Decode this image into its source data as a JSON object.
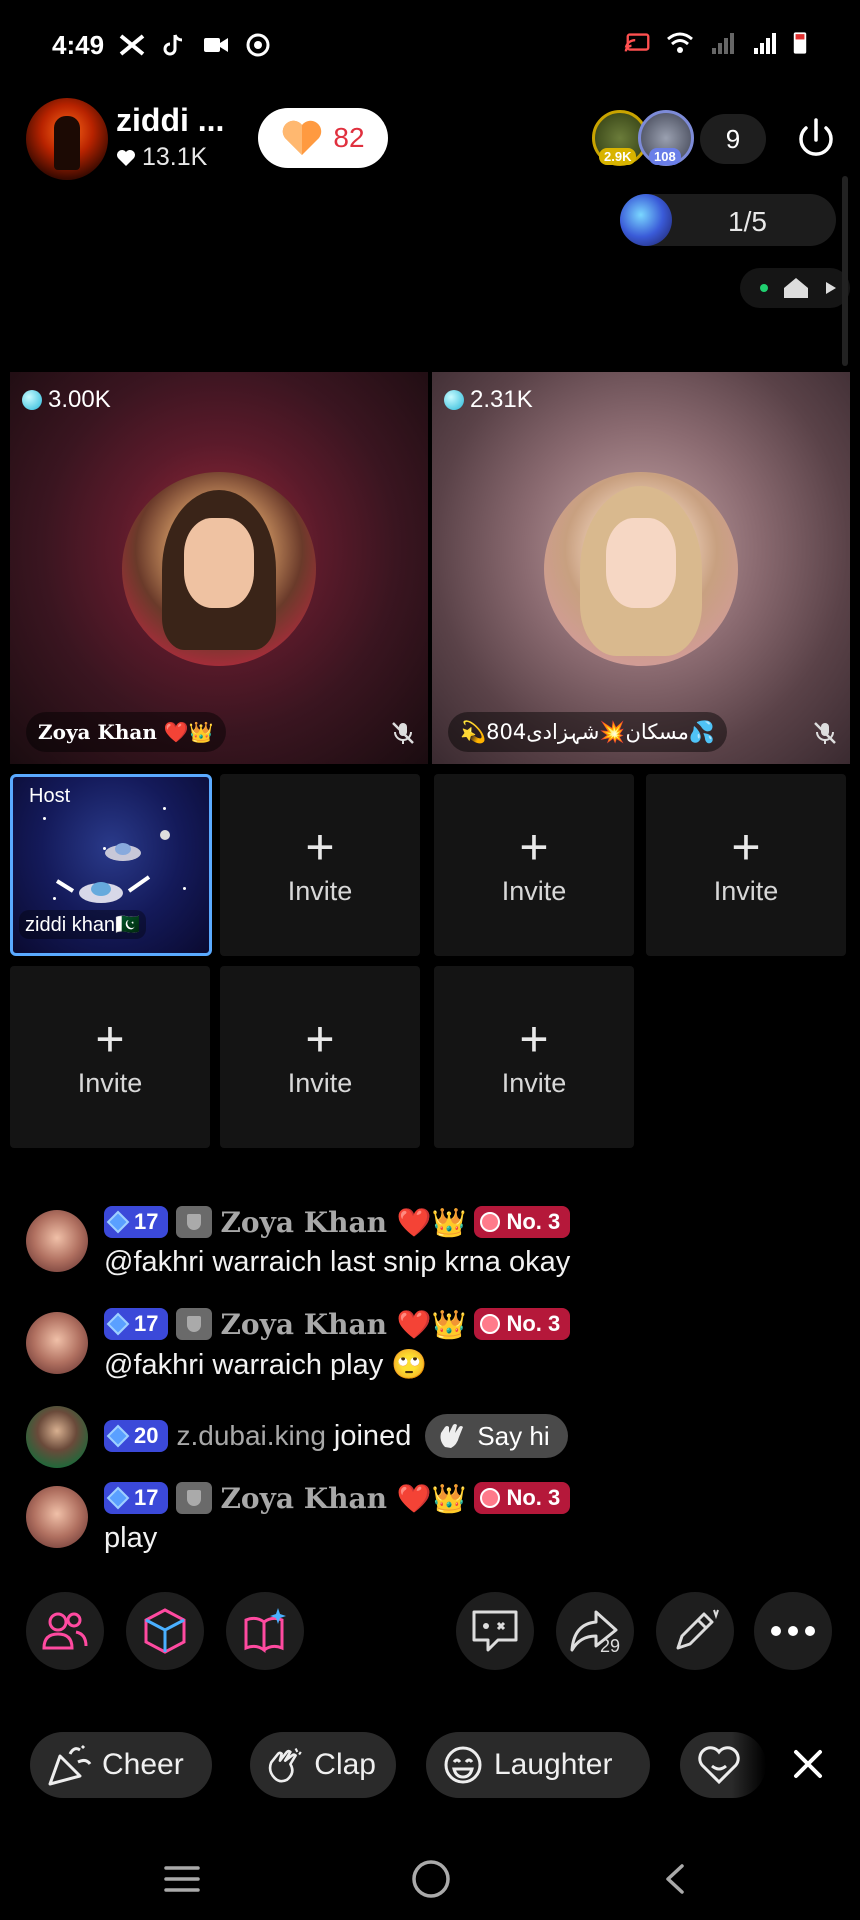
{
  "status_bar": {
    "time": "4:49",
    "left_icons": [
      "capcut-icon",
      "tiktok-icon",
      "video-camera-icon",
      "record-icon"
    ],
    "right_icons": [
      "cast-icon",
      "wifi-icon",
      "signal-icon",
      "signal-icon",
      "battery-icon"
    ]
  },
  "header": {
    "host_name": "ziddi ...",
    "host_likes": "13.1K",
    "heart_count": "82",
    "viewer_badges": [
      "2.9K",
      "108"
    ],
    "viewer_count": "9",
    "rank_text": "1/5"
  },
  "seats_big": [
    {
      "score": "3.00K",
      "name": "Zoya Khan ❤️👑"
    },
    {
      "score": "2.31K",
      "name": "💫804مسکان💥شہزادی💦"
    }
  ],
  "host_seat": {
    "tag": "Host",
    "name": "ziddi khan🇵🇰"
  },
  "invite_label": "Invite",
  "chat": [
    {
      "level": "17",
      "user": "Zoya Khan ❤️👑",
      "rank": "No. 3",
      "text": "@fakhri warraich last snip krna okay"
    },
    {
      "level": "17",
      "user": "Zoya Khan ❤️👑",
      "rank": "No. 3",
      "text": "@fakhri warraich play 🙄"
    },
    {
      "level": "20",
      "user": "z.dubai.king",
      "action": "joined",
      "say_hi": "Say hi"
    },
    {
      "level": "17",
      "user": "Zoya Khan ❤️👑",
      "rank": "No. 3",
      "text": "play"
    }
  ],
  "action_icons": {
    "left": [
      "users-icon",
      "cube-icon",
      "magic-book-icon"
    ],
    "right": [
      "chat-bubble-icon",
      "share-icon",
      "pen-icon",
      "more-icon"
    ],
    "share_count": "29"
  },
  "reactions": [
    "Cheer",
    "Clap",
    "Laughter"
  ],
  "colors": {
    "accent_level": "#3b49d9",
    "rank_badge": "#b5183a",
    "heart": "#e0303e",
    "host_border": "#5aaaff"
  }
}
